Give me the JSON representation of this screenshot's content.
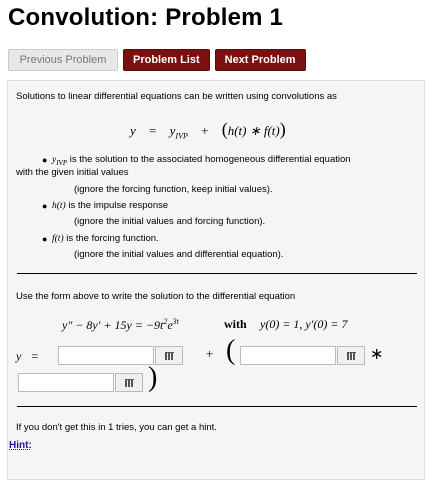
{
  "title": "Convolution: Problem 1",
  "nav": {
    "prev": "Previous Problem",
    "list": "Problem List",
    "next": "Next Problem"
  },
  "intro": "Solutions to linear differential equations can be written using convolutions as",
  "formula": {
    "y": "y",
    "eq": "=",
    "yivp": "y",
    "yivp_sub": "IVP",
    "plus": "+",
    "h": "h(t) ∗ f(t)"
  },
  "bullets": [
    {
      "term": "y",
      "term_sub": "IVP",
      "text": "is the solution to the associated homogeneous differential equation",
      "cont": "with the given initial values",
      "note": "(ignore the forcing function, keep initial values)."
    },
    {
      "term": "h(t)",
      "text": "is the impulse response",
      "note": "(ignore the initial values and forcing function)."
    },
    {
      "term": "f(t)",
      "text": "is the forcing function.",
      "note": "(ignore the initial values and differential equation)."
    }
  ],
  "instruction": "Use the form above to write the solution to the differential equation",
  "de": {
    "lhs": "y″ − 8y′ + 15y = −9t",
    "exp1": "2",
    "e": "e",
    "exp2": "3t",
    "with": "with",
    "ic": "y(0) = 1,   y′(0) = 7"
  },
  "answer_row": {
    "y": "y",
    "eq": "=",
    "plus": "+",
    "star": "∗"
  },
  "tries_text": "If you don't get this in 1 tries, you can get a hint.",
  "hint": "Hint:"
}
